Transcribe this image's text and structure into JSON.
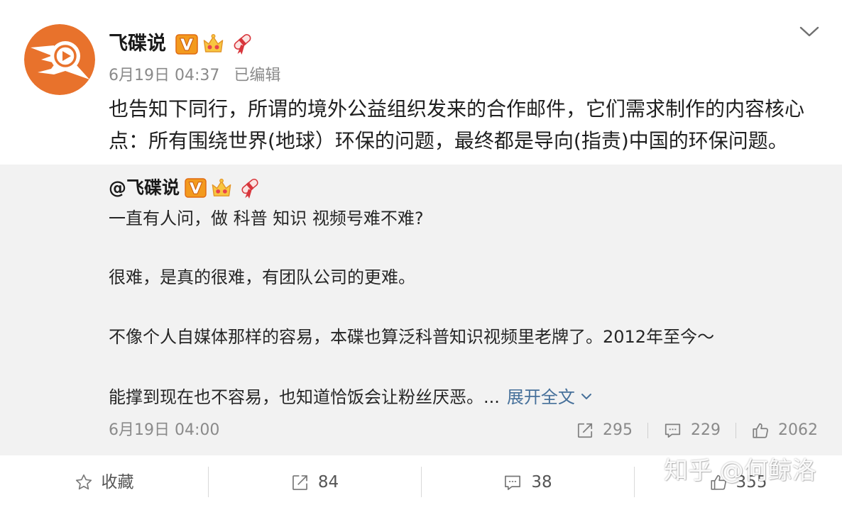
{
  "colors": {
    "brand_orange": "#E8722C",
    "text": "#222222",
    "meta": "#8a8a8a",
    "link": "#46709A",
    "repost_bg": "#F2F2F2"
  },
  "post": {
    "author": {
      "name": "飞碟说",
      "avatar_icon": "feidieshuo-logo",
      "badges": [
        "verified-v-icon",
        "crown-icon",
        "ribbon-icon"
      ]
    },
    "menu_icon": "chevron-down-icon",
    "date": "6月19日 04:37",
    "edited_label": "已编辑",
    "text_lines": [
      "也告知下同行，所谓的境外公益组织发来的合作邮件，它们需求制作的内容核心",
      "点：所有围绕世界(地球）环保的问题，最终都是导向(指责)中国的环保问题。"
    ]
  },
  "repost": {
    "mention": "@飞碟说",
    "badges": [
      "verified-v-icon",
      "crown-icon",
      "ribbon-icon"
    ],
    "paragraphs": [
      "一直有人问，做 科普 知识 视频号难不难?",
      "很难，是真的很难，有团队公司的更难。",
      "不像个人自媒体那样的容易，本碟也算泛科普知识视频里老牌了。2012年至今～",
      "能撑到现在也不容易，也知道恰饭会让粉丝厌恶。..."
    ],
    "expand_label": "展开全文",
    "date": "6月19日 04:00",
    "stats": {
      "reposts": 295,
      "comments": 229,
      "likes": 2062
    }
  },
  "actions": {
    "favorite_label": "收藏",
    "favorite_icon": "star-icon",
    "reposts": 84,
    "comments": 38,
    "likes": 355
  },
  "watermark": "知乎 @何鲸洛"
}
